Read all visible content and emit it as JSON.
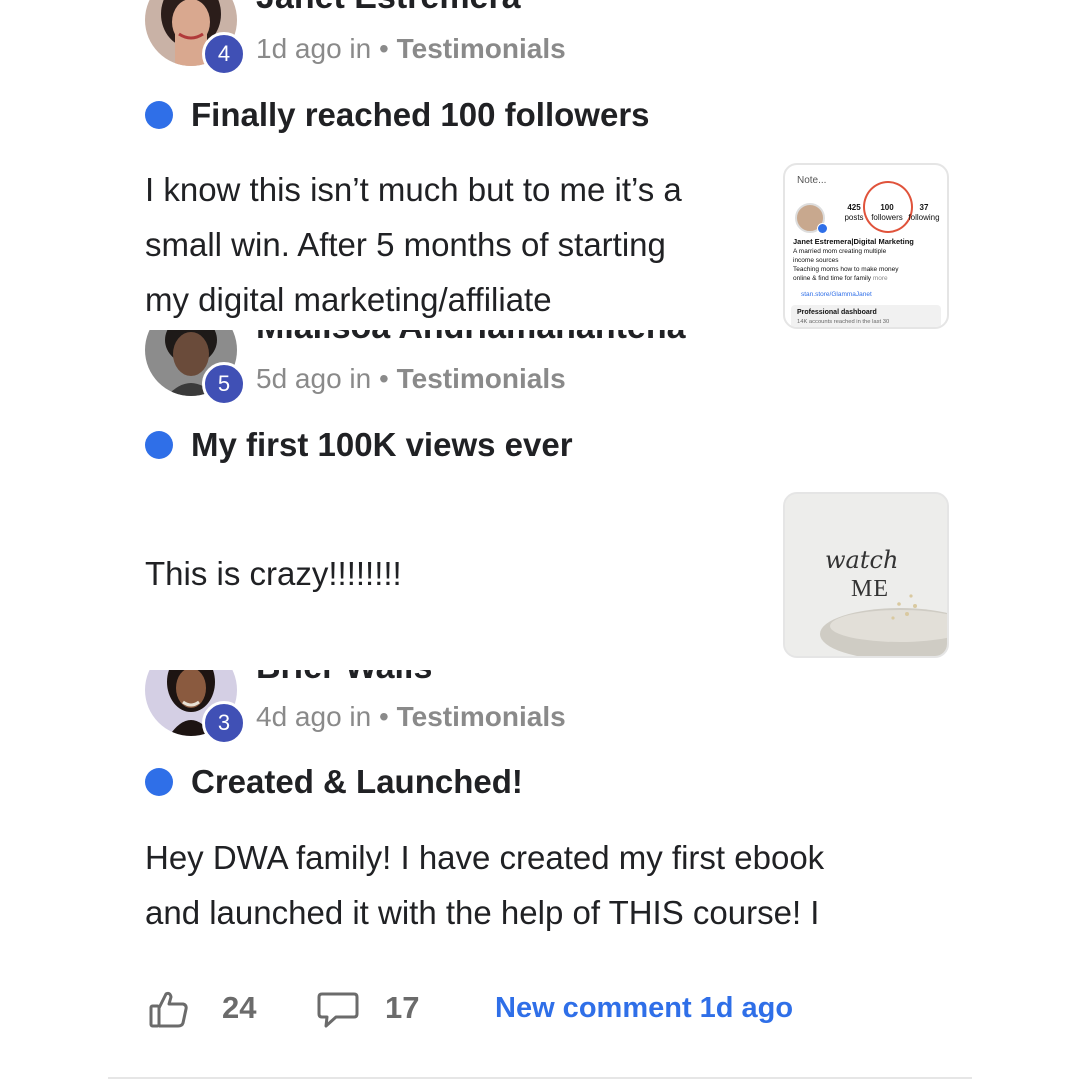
{
  "posts": [
    {
      "author": "Janet Estremera",
      "level": "4",
      "time": "1d ago in",
      "separator": "•",
      "category": "Testimonials",
      "title": "Finally reached 100 followers",
      "body_lines": [
        "I know this isn’t much but to me it’s a",
        "small win. After 5 months of starting",
        "my digital marketing/affiliate"
      ],
      "thumbnail": {
        "note": "Note...",
        "stats": [
          {
            "value": "425",
            "label": "posts"
          },
          {
            "value": "100",
            "label": "followers"
          },
          {
            "value": "37",
            "label": "following"
          }
        ],
        "profile_name": "Janet Estremera|Digital Marketing",
        "bio_lines": [
          "A married mom creating multiple",
          "income sources",
          "Teaching moms how to make money",
          "online & find time for family",
          "more"
        ],
        "link": "stan.store/GlammaJanet",
        "dashboard_title": "Professional dashboard",
        "dashboard_sub": "14K accounts reached in the last 30"
      }
    },
    {
      "author": "Mialisoa Andriamahantena",
      "level": "5",
      "time": "5d ago in",
      "separator": "•",
      "category": "Testimonials",
      "title": "My first 100K views ever",
      "body_lines": [
        "This is crazy!!!!!!!!"
      ],
      "thumbnail": {
        "script_text": "watch",
        "caps_text": "ME"
      }
    },
    {
      "author": "Brier Walls",
      "level": "3",
      "time": "4d ago in",
      "separator": "•",
      "category": "Testimonials",
      "title": "Created & Launched!",
      "body_lines": [
        "Hey DWA family! I have created my first ebook",
        "and launched it with the help of THIS course! I"
      ]
    }
  ],
  "footer": {
    "likes": "24",
    "comments": "17",
    "new_comment": "New comment 1d ago"
  },
  "colors": {
    "accent": "#2f6fe8",
    "level_badge": "#4050b5",
    "muted": "#8a8a8a"
  }
}
